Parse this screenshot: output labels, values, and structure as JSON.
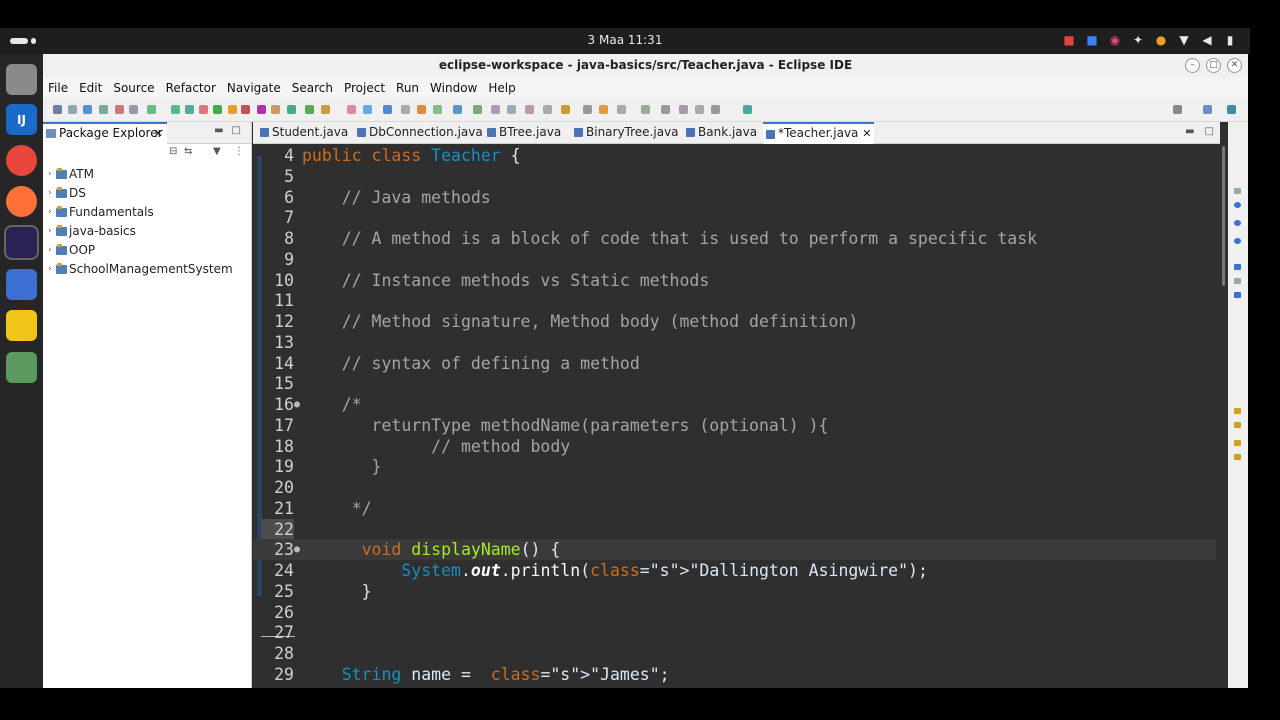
{
  "system": {
    "clock": "3 Maa  11:31",
    "tray_icons": [
      "camera-icon",
      "screen-share-icon",
      "color-picker-icon",
      "accessibility-icon",
      "microphone-icon",
      "wifi-icon",
      "volume-icon",
      "battery-icon"
    ]
  },
  "dock": {
    "apps": [
      {
        "name": "files-icon",
        "color": "#8a8a8a",
        "label": ""
      },
      {
        "name": "intellij-icon",
        "color": "#1b6ac9",
        "label": "IJ"
      },
      {
        "name": "chrome-icon",
        "color": "#e8453c",
        "label": ""
      },
      {
        "name": "firefox-icon",
        "color": "#ff7139",
        "label": ""
      },
      {
        "name": "eclipse-icon",
        "color": "#2c2255",
        "label": ""
      },
      {
        "name": "screenshot-icon",
        "color": "#3b6fd1",
        "label": ""
      },
      {
        "name": "text-editor-icon",
        "color": "#f0c419",
        "label": ""
      },
      {
        "name": "trash-icon",
        "color": "#5b9a5e",
        "label": ""
      }
    ]
  },
  "window": {
    "title": "eclipse-workspace - java-basics/src/Teacher.java - Eclipse IDE"
  },
  "menu": [
    "File",
    "Edit",
    "Source",
    "Refactor",
    "Navigate",
    "Search",
    "Project",
    "Run",
    "Window",
    "Help"
  ],
  "package_explorer": {
    "tab_label": "Package Explorer",
    "projects": [
      "ATM",
      "DS",
      "Fundamentals",
      "java-basics",
      "OOP",
      "SchoolManagementSystem"
    ]
  },
  "editor": {
    "tabs": [
      "Student.java",
      "DbConnection.java",
      "BTree.java",
      "BinaryTree.java",
      "Bank.java",
      "*Teacher.java"
    ],
    "active_tab": "*Teacher.java",
    "current_line": 23,
    "lines": [
      {
        "n": "4",
        "text": "public class Teacher {"
      },
      {
        "n": "5",
        "text": ""
      },
      {
        "n": "6",
        "text": "    // Java methods"
      },
      {
        "n": "7",
        "text": ""
      },
      {
        "n": "8",
        "text": "    // A method is a block of code that is used to perform a specific task"
      },
      {
        "n": "9",
        "text": ""
      },
      {
        "n": "10",
        "text": "    // Instance methods vs Static methods"
      },
      {
        "n": "11",
        "text": ""
      },
      {
        "n": "12",
        "text": "    // Method signature, Method body (method definition)"
      },
      {
        "n": "13",
        "text": ""
      },
      {
        "n": "14",
        "text": "    // syntax of defining a method"
      },
      {
        "n": "15",
        "text": ""
      },
      {
        "n": "16",
        "text": "    /*"
      },
      {
        "n": "17",
        "text": "       returnType methodName(parameters (optional) ){"
      },
      {
        "n": "18",
        "text": "             // method body"
      },
      {
        "n": "19",
        "text": "       }"
      },
      {
        "n": "20",
        "text": ""
      },
      {
        "n": "21",
        "text": "     */"
      },
      {
        "n": "22",
        "text": ""
      },
      {
        "n": "23",
        "text": "      void displayName() {"
      },
      {
        "n": "24",
        "text": "          System.out.println(\"Dallington Asingwire\");"
      },
      {
        "n": "25",
        "text": "      }"
      },
      {
        "n": "26",
        "text": ""
      },
      {
        "n": "27",
        "text": ""
      },
      {
        "n": "28",
        "text": ""
      },
      {
        "n": "29",
        "text": "    String name =  \"James\";"
      }
    ]
  }
}
